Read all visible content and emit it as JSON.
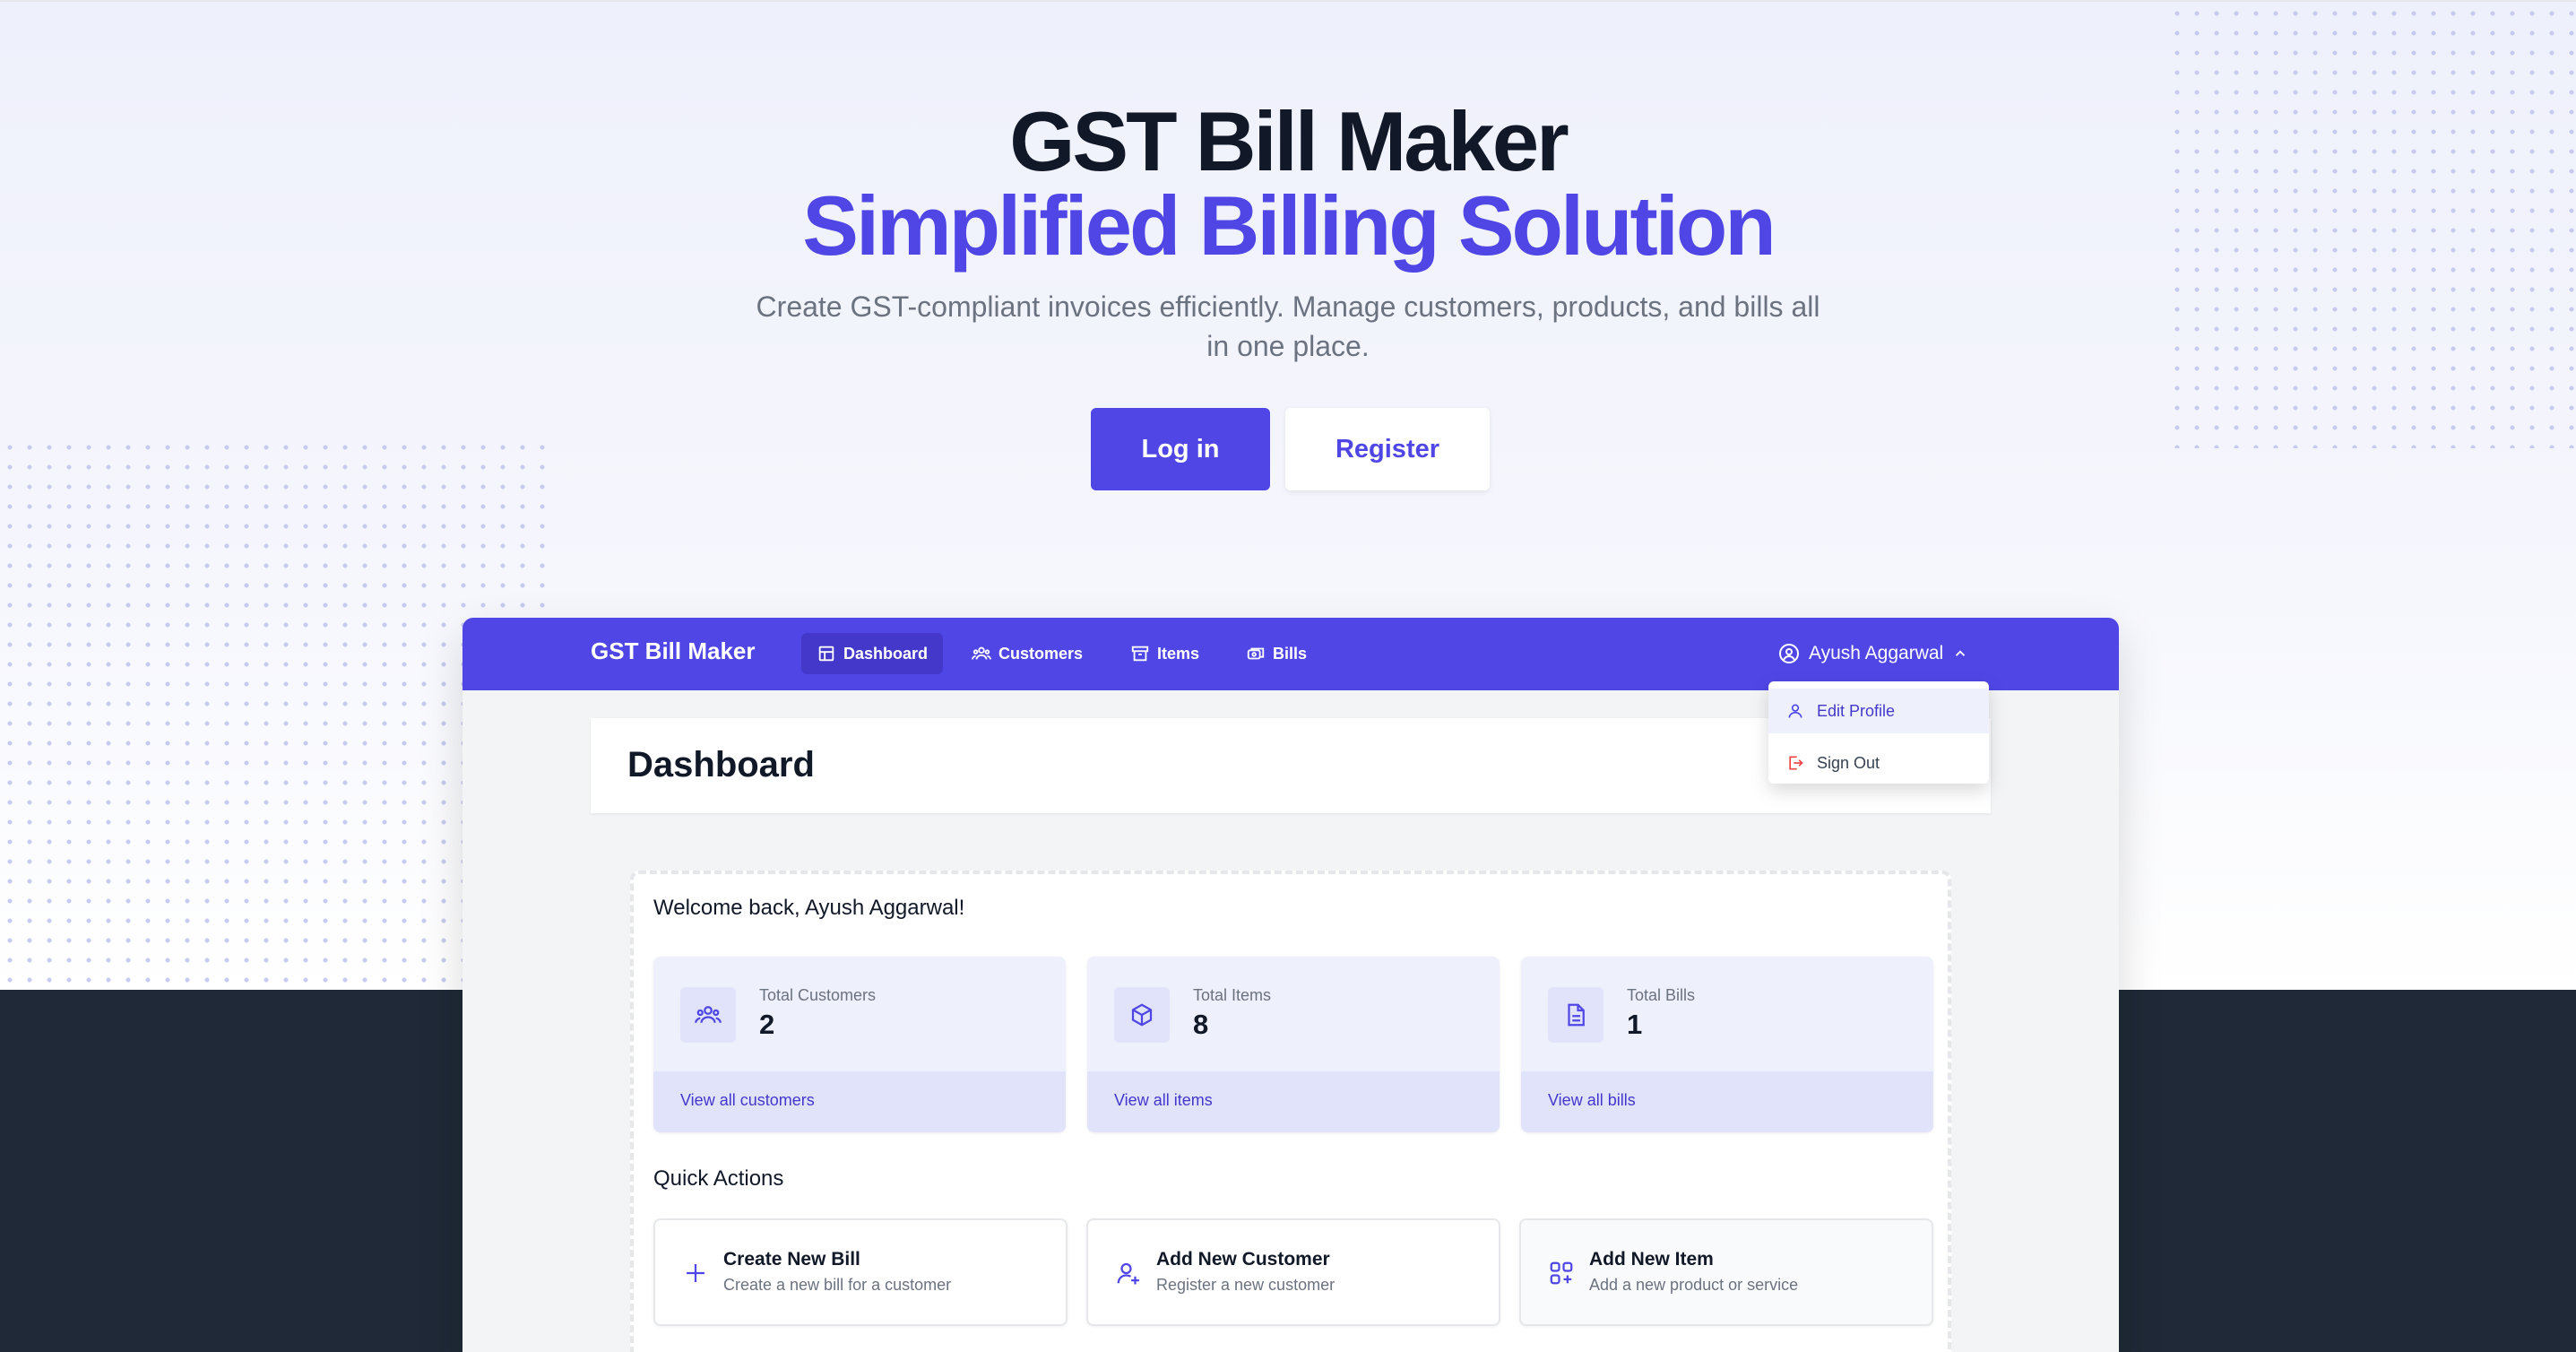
{
  "hero": {
    "title_line1": "GST Bill Maker",
    "title_line2": "Simplified Billing Solution",
    "subtitle": "Create GST-compliant invoices efficiently. Manage customers, products, and bills all in one place.",
    "login_label": "Log in",
    "register_label": "Register"
  },
  "colors": {
    "accent": "#4f46e5",
    "accent_dark": "#4338ca",
    "footer_bg": "#1f2937",
    "danger": "#ef4444"
  },
  "navbar": {
    "brand": "GST Bill Maker",
    "items": [
      {
        "label": "Dashboard",
        "icon": "dashboard-icon",
        "active": true
      },
      {
        "label": "Customers",
        "icon": "users-icon",
        "active": false
      },
      {
        "label": "Items",
        "icon": "archive-icon",
        "active": false
      },
      {
        "label": "Bills",
        "icon": "bills-icon",
        "active": false
      }
    ],
    "user_name": "Ayush Aggarwal"
  },
  "user_dropdown": {
    "items": [
      {
        "label": "Edit Profile",
        "icon": "user-icon"
      },
      {
        "label": "Sign Out",
        "icon": "sign-out-icon"
      }
    ]
  },
  "page": {
    "title": "Dashboard",
    "welcome": "Welcome back, Ayush Aggarwal!"
  },
  "stats": [
    {
      "label": "Total Customers",
      "value": "2",
      "link": "View all customers",
      "icon": "users-icon"
    },
    {
      "label": "Total Items",
      "value": "8",
      "link": "View all items",
      "icon": "cube-icon"
    },
    {
      "label": "Total Bills",
      "value": "1",
      "link": "View all bills",
      "icon": "document-icon"
    }
  ],
  "quick_actions": {
    "title": "Quick Actions",
    "items": [
      {
        "name": "Create New Bill",
        "desc": "Create a new bill for a customer",
        "icon": "plus-icon"
      },
      {
        "name": "Add New Customer",
        "desc": "Register a new customer",
        "icon": "user-plus-icon"
      },
      {
        "name": "Add New Item",
        "desc": "Add a new product or service",
        "icon": "squares-plus-icon"
      }
    ]
  }
}
